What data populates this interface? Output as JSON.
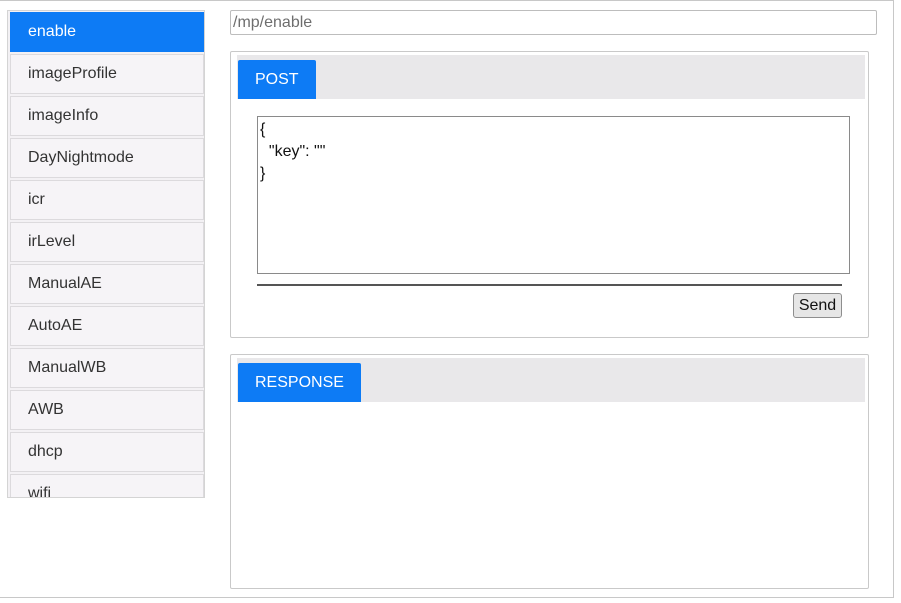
{
  "sidebar": {
    "items": [
      {
        "label": "enable",
        "active": true
      },
      {
        "label": "imageProfile"
      },
      {
        "label": "imageInfo"
      },
      {
        "label": "DayNightmode"
      },
      {
        "label": "icr"
      },
      {
        "label": "irLevel"
      },
      {
        "label": "ManualAE"
      },
      {
        "label": "AutoAE"
      },
      {
        "label": "ManualWB"
      },
      {
        "label": "AWB"
      },
      {
        "label": "dhcp"
      },
      {
        "label": "wifi"
      }
    ]
  },
  "url": {
    "placeholder": "/mp/enable",
    "value": ""
  },
  "request": {
    "method_tab": "POST",
    "body": "{\n  \"key\": \"\"\n}",
    "send_label": "Send"
  },
  "response": {
    "tab": "RESPONSE",
    "body": ""
  },
  "colors": {
    "accent": "#0d7bf5",
    "tabbar": "#e9e8ea",
    "sidebar_item": "#f6f4f7"
  }
}
